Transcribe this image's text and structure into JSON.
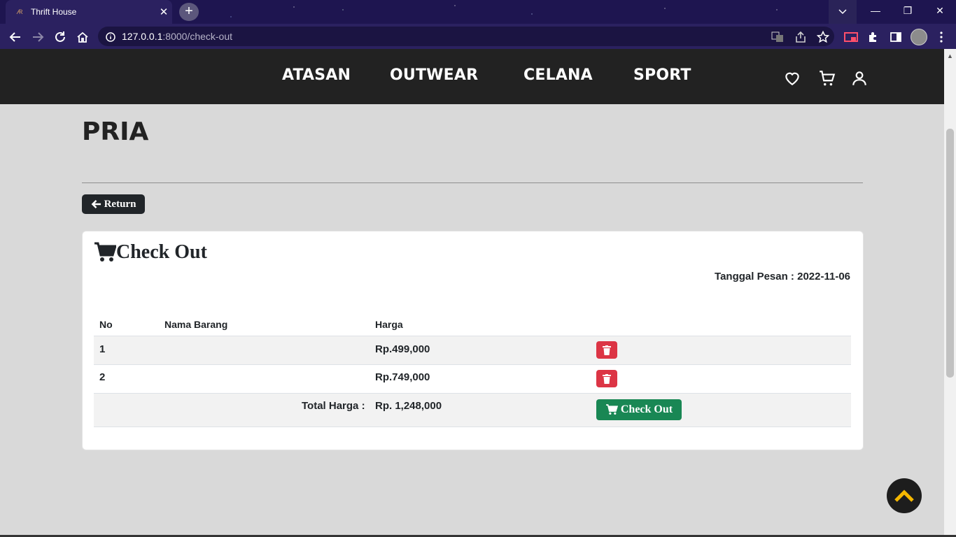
{
  "browser": {
    "tab_title": "Thrift House",
    "tab_favicon": "🜇",
    "tab_close": "✕",
    "new_tab": "+",
    "url_host": "127.0.0.1",
    "url_path": ":8000/check-out",
    "window_minimize": "—",
    "window_restore": "❐",
    "window_close": "✕",
    "icons": [
      "back-icon",
      "forward-icon",
      "reload-icon",
      "home-icon",
      "site-info-icon",
      "translate-icon",
      "share-icon",
      "bookmark-star-icon",
      "cast-icon",
      "extensions-icon",
      "side-panel-icon",
      "profile-avatar",
      "menu-icon"
    ]
  },
  "nav": {
    "links": [
      "ATASAN",
      "OUTWEAR",
      "CELANA",
      "SPORT"
    ],
    "icons": [
      "heart-icon",
      "cart-icon",
      "user-icon"
    ]
  },
  "page": {
    "title": "PRIA",
    "return_label": "Return"
  },
  "checkout": {
    "title": "Check Out",
    "order_date": "Tanggal Pesan : 2022-11-06",
    "headers": {
      "no": "No",
      "name": "Nama Barang",
      "price": "Harga"
    },
    "items": [
      {
        "no": "1",
        "name": "",
        "price": "Rp.499,000"
      },
      {
        "no": "2",
        "name": "",
        "price": "Rp.749,000"
      }
    ],
    "total_label": "Total Harga :",
    "total_value": "Rp. 1,248,000",
    "checkout_label": "Check Out"
  },
  "colors": {
    "nav_bg": "#222222",
    "page_bg": "#d9d9d9",
    "delete": "#dc3545",
    "checkout": "#198754",
    "to_top_arrow": "#f5b700"
  }
}
